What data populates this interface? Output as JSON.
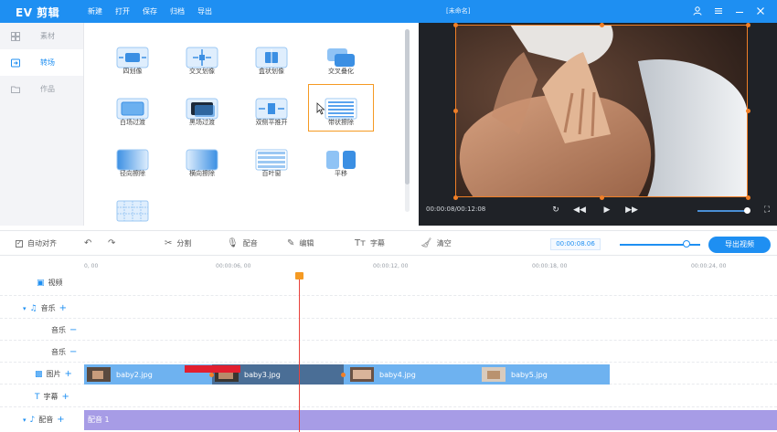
{
  "app": {
    "logo": "EV 剪辑",
    "menu": [
      "新建",
      "打开",
      "保存",
      "归档",
      "导出"
    ],
    "doc_title": "[未命名]"
  },
  "sidebar": {
    "items": [
      {
        "label": "素材",
        "active": false
      },
      {
        "label": "转场",
        "active": true
      },
      {
        "label": "作品",
        "active": false
      }
    ]
  },
  "transitions": {
    "items": [
      {
        "label": "四划像"
      },
      {
        "label": "交叉划像"
      },
      {
        "label": "盒状划像"
      },
      {
        "label": "交叉叠化"
      },
      {
        "label": "白场过渡"
      },
      {
        "label": "黑场过渡"
      },
      {
        "label": "双侧平推开"
      },
      {
        "label": "带状擦除",
        "selected": true
      },
      {
        "label": "径向擦除"
      },
      {
        "label": "横向擦除"
      },
      {
        "label": "百叶窗"
      },
      {
        "label": "平移"
      },
      {
        "label": ""
      }
    ]
  },
  "preview": {
    "time": "00:00:08/00:12:08",
    "volume": 0.95
  },
  "toolbar": {
    "auto_align": "自动对齐",
    "split": "分割",
    "dub": "配音",
    "edit": "编辑",
    "subtitle": "字幕",
    "clear": "清空",
    "time": "00:00:08.06",
    "export": "导出视频",
    "zoom": 0.83
  },
  "timeline": {
    "ruler": [
      "0, 00",
      "00:00:06, 00",
      "00:00:12, 00",
      "00:00:18, 00",
      "00:00:24, 00"
    ],
    "tracks": [
      {
        "label": "视频"
      },
      {
        "label": "音乐"
      },
      {
        "label": "音乐"
      },
      {
        "label": "音乐"
      },
      {
        "label": "图片"
      },
      {
        "label": "字幕"
      },
      {
        "label": "配音"
      }
    ],
    "clips": [
      {
        "name": "baby2.jpg"
      },
      {
        "name": "baby3.jpg"
      },
      {
        "name": "baby4.jpg"
      },
      {
        "name": "baby5.jpg"
      }
    ],
    "dub_clip": "配音 1"
  }
}
